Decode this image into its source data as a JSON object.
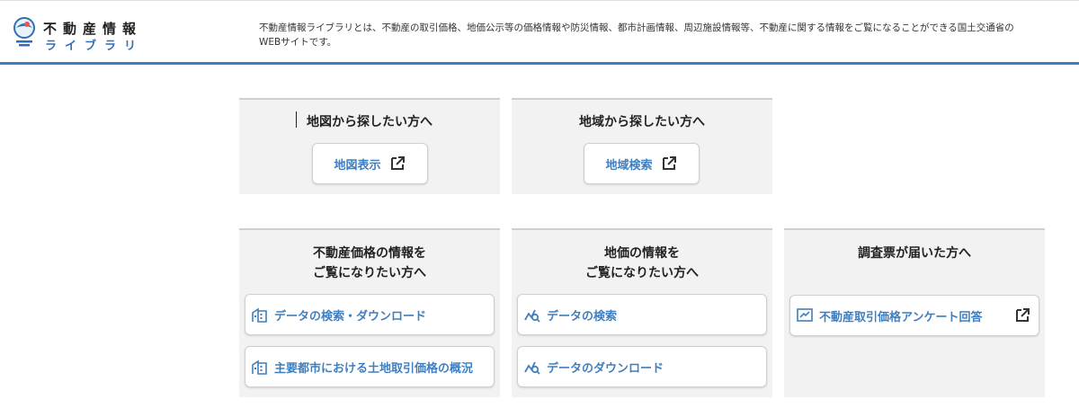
{
  "header": {
    "logo_title": "不動産情報",
    "logo_subtitle": "ライブラリ",
    "description": "不動産情報ライブラリとは、不動産の取引価格、地価公示等の価格情報や防災情報、都市計画情報、周辺施設情報等、不動産に関する情報をご覧になることができる国土交通省のWEBサイトです。",
    "accent_color": "#3f7fc0"
  },
  "map_card": {
    "title": "地図から探したい方へ",
    "button_label": "地図表示",
    "button_icon": "external-link-icon"
  },
  "area_card": {
    "title": "地域から探したい方へ",
    "button_label": "地域検索",
    "button_icon": "external-link-icon"
  },
  "price_card": {
    "title_line1": "不動産価格の情報を",
    "title_line2": "ご覧になりたい方へ",
    "items": [
      {
        "label": "データの検索・ダウンロード",
        "icon": "building-icon"
      },
      {
        "label": "主要都市における土地取引価格の概況",
        "icon": "building-icon"
      }
    ]
  },
  "land_card": {
    "title_line1": "地価の情報を",
    "title_line2": "ご覧になりたい方へ",
    "items": [
      {
        "label": "データの検索",
        "icon": "chart-search-icon"
      },
      {
        "label": "データのダウンロード",
        "icon": "chart-search-icon"
      }
    ]
  },
  "survey_card": {
    "title": "調査票が届いた方へ",
    "button_label": "不動産取引価格アンケート回答",
    "button_icon": "survey-form-icon",
    "button_trailing_icon": "external-link-icon"
  }
}
